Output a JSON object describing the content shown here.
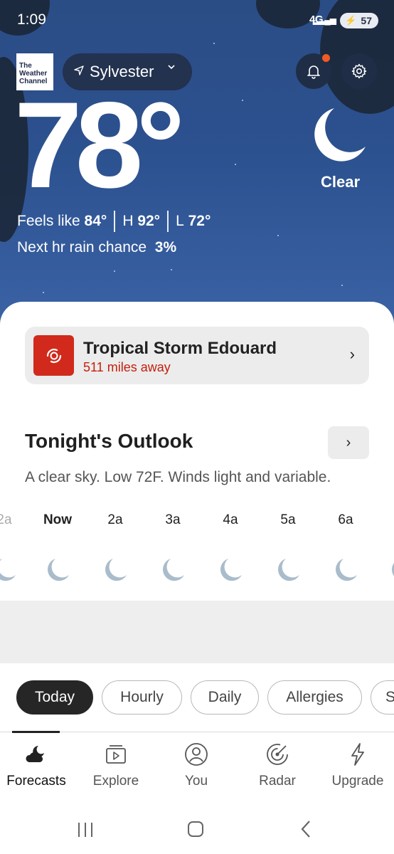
{
  "status_bar": {
    "time": "1:09",
    "network": "4G",
    "battery": "57"
  },
  "header": {
    "logo_text": "The Weather Channel",
    "location": "Sylvester",
    "notification_icon": "bell-icon",
    "settings_icon": "gear-icon"
  },
  "current": {
    "temperature": "78°",
    "condition": "Clear",
    "feels_like_label": "Feels like ",
    "feels_like_value": "84°",
    "high_label": "H ",
    "high_value": "92°",
    "low_label": "L ",
    "low_value": "72°",
    "rain_label": "Next hr rain chance ",
    "rain_value": "3%"
  },
  "alert": {
    "title": "Tropical Storm Edouard",
    "subtitle": "511 miles away",
    "icon": "hurricane-icon"
  },
  "outlook": {
    "title": "Tonight's Outlook",
    "description": "A clear sky. Low 72F. Winds light and variable."
  },
  "hourly": [
    {
      "label": "2a",
      "icon": "moon-icon"
    },
    {
      "label": "Now",
      "icon": "moon-icon"
    },
    {
      "label": "2a",
      "icon": "moon-icon"
    },
    {
      "label": "3a",
      "icon": "moon-icon"
    },
    {
      "label": "4a",
      "icon": "moon-icon"
    },
    {
      "label": "5a",
      "icon": "moon-icon"
    },
    {
      "label": "6a",
      "icon": "moon-icon"
    },
    {
      "label": "",
      "icon": "moon-icon"
    }
  ],
  "tabs": [
    {
      "label": "Today",
      "active": true
    },
    {
      "label": "Hourly",
      "active": false
    },
    {
      "label": "Daily",
      "active": false
    },
    {
      "label": "Allergies",
      "active": false
    },
    {
      "label": "S",
      "active": false
    }
  ],
  "bottom_nav": [
    {
      "label": "Forecasts",
      "icon": "cloud-moon-icon",
      "active": true
    },
    {
      "label": "Explore",
      "icon": "video-icon",
      "active": false
    },
    {
      "label": "You",
      "icon": "user-icon",
      "active": false
    },
    {
      "label": "Radar",
      "icon": "radar-icon",
      "active": false
    },
    {
      "label": "Upgrade",
      "icon": "lightning-icon",
      "active": false
    }
  ],
  "system_nav": [
    "recents-icon",
    "home-icon",
    "back-icon"
  ],
  "colors": {
    "sky": "#2c518f",
    "alert_red": "#d12a1c",
    "moon_gray": "#a9bccb",
    "accent_orange": "#f15a24"
  }
}
